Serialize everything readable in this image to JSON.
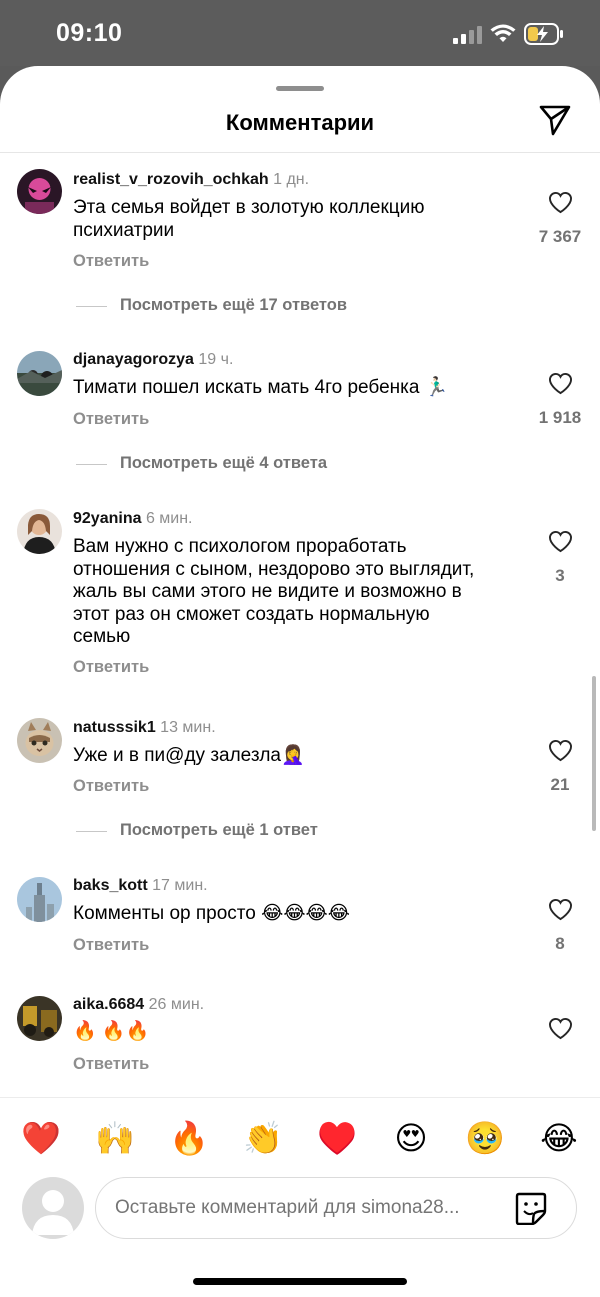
{
  "status": {
    "time": "09:10"
  },
  "header": {
    "title": "Комментарии"
  },
  "comments": [
    {
      "username": "realist_v_rozovih_ochkah",
      "time": "1 дн.",
      "lines": [
        "Эта семья войдет в золотую коллекцию",
        "психиатрии"
      ],
      "reply": "Ответить",
      "likes": "7 367",
      "view_replies": "Посмотреть ещё 17 ответов"
    },
    {
      "username": "djanayagorozya",
      "time": "19 ч.",
      "lines": [
        "Тимати пошел искать мать 4го ребенка 🏃🏻‍♂️"
      ],
      "reply": "Ответить",
      "likes": "1 918",
      "view_replies": "Посмотреть ещё 4 ответа"
    },
    {
      "username": "92yanina",
      "time": "6 мин.",
      "lines": [
        "Вам нужно с психологом проработать",
        "отношения  с сыном, нездорово это выглядит,",
        "жаль вы сами этого не видите  и возможно в",
        "этот раз он сможет создать нормальную",
        "семью"
      ],
      "reply": "Ответить",
      "likes": "3"
    },
    {
      "username": "natusssik1",
      "time": "13 мин.",
      "lines": [
        "Уже и в пи@ду залезла🤦‍♀️"
      ],
      "reply": "Ответить",
      "likes": "21",
      "view_replies": "Посмотреть ещё 1 ответ"
    },
    {
      "username": "baks_kott",
      "time": "17 мин.",
      "lines": [
        "Комменты ор просто 😂😂😂😂"
      ],
      "reply": "Ответить",
      "likes": "8"
    },
    {
      "username": "aika.6684",
      "time": "26 мин.",
      "lines": [
        "🔥 🔥🔥"
      ],
      "reply": "Ответить"
    }
  ],
  "emoji_bar": [
    "❤️",
    "🙌",
    "🔥",
    "👏",
    "♥️",
    "😍",
    "🥹",
    "😂"
  ],
  "input": {
    "placeholder": "Оставьте комментарий для simona28..."
  },
  "colors": {
    "muted": "#8e8e8e",
    "heart": "#262626"
  }
}
